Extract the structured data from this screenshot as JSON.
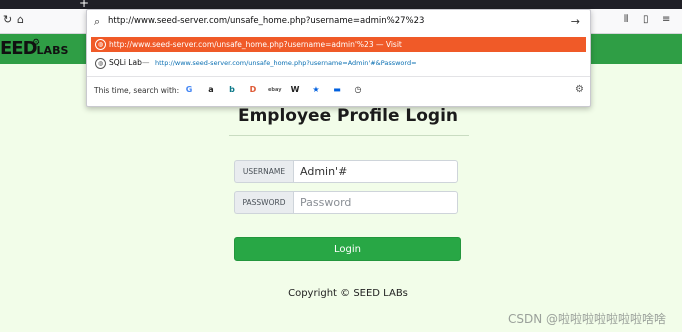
{
  "browser": {
    "new_tab_glyph": "+",
    "url_text": "http://www.seed-server.com/unsafe_home.php?username=admin%27%23",
    "go_glyph": "→",
    "suggestions": [
      {
        "text": "http://www.seed-server.com/unsafe_home.php?username=admin'%23 — Visit"
      },
      {
        "title": "SQLi Lab",
        "separator": "—",
        "url": "http://www.seed-server.com/unsafe_home.php?username=Admin'#&Password="
      }
    ],
    "search_with_label": "This time, search with:",
    "engines": [
      {
        "name": "google-icon",
        "glyph": "G",
        "color": "#4285f4"
      },
      {
        "name": "amazon-icon",
        "glyph": "a",
        "color": "#222222"
      },
      {
        "name": "bing-icon",
        "glyph": "b",
        "color": "#0f7a8a"
      },
      {
        "name": "duckduckgo-icon",
        "glyph": "D",
        "color": "#de5833"
      },
      {
        "name": "ebay-icon",
        "glyph": "ebay",
        "color": "#555555"
      },
      {
        "name": "wikipedia-icon",
        "glyph": "W",
        "color": "#222222"
      },
      {
        "name": "bookmarks-star-icon",
        "glyph": "★",
        "color": "#0060df"
      },
      {
        "name": "tabs-icon",
        "glyph": "▬",
        "color": "#0060df"
      },
      {
        "name": "history-icon",
        "glyph": "◷",
        "color": "#222222"
      }
    ]
  },
  "site": {
    "logo_big": "EED",
    "logo_small": "LABS"
  },
  "page": {
    "title": "Employee Profile Login",
    "username_label": "USERNAME",
    "username_value": "Admin'#",
    "password_label": "PASSWORD",
    "password_placeholder": "Password",
    "login_button": "Login",
    "copyright": "Copyright © SEED LABs"
  },
  "watermark": "CSDN @啦啦啦啦啦啦啦啥啥"
}
